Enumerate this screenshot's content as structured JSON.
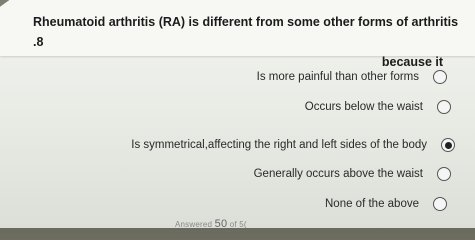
{
  "question": {
    "line1": "Rheumatoid arthritis (RA) is different from some other forms of arthritis .8",
    "line2": "because it"
  },
  "options": [
    {
      "label": "Is more painful than other forms",
      "selected": false
    },
    {
      "label": "Occurs below the waist",
      "selected": false
    },
    {
      "label": "Is symmetrical,affecting the right and left sides of the body",
      "selected": true
    },
    {
      "label": "Generally occurs above the waist",
      "selected": false
    },
    {
      "label": "None of the above",
      "selected": false
    }
  ],
  "footer": {
    "prefix": "Answered",
    "count": "50",
    "suffix": "of 5("
  }
}
